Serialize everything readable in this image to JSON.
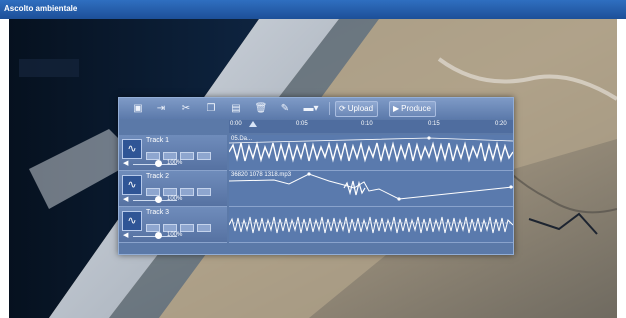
{
  "window": {
    "title": "Ascolto ambientale"
  },
  "toolbar": {
    "upload_label": "Upload",
    "produce_label": "Produce"
  },
  "ruler": {
    "ticks": [
      "0:00",
      "0:05",
      "0:10",
      "0:15",
      "0:20"
    ]
  },
  "tracks": [
    {
      "name": "Track 1",
      "volume": "100%",
      "clip": "05.Da..."
    },
    {
      "name": "Track 2",
      "volume": "100%",
      "clip": "36820 1078 1318.mp3"
    },
    {
      "name": "Track 3",
      "volume": "100%",
      "clip": ""
    }
  ]
}
